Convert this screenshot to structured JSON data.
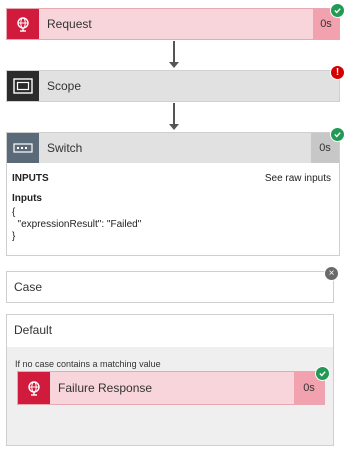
{
  "request": {
    "label": "Request",
    "duration": "0s",
    "icon": "globe-icon",
    "status": "success"
  },
  "scope": {
    "label": "Scope",
    "icon": "scope-icon",
    "status": "error",
    "status_glyph": "!"
  },
  "switch": {
    "label": "Switch",
    "duration": "0s",
    "icon": "switch-icon",
    "status": "success",
    "inputs_header": "INPUTS",
    "raw_link": "See raw inputs",
    "inputs_label": "Inputs",
    "code_lines": [
      "{",
      "  \"expressionResult\": \"Failed\"",
      "}"
    ]
  },
  "case": {
    "label": "Case",
    "close_glyph": "×"
  },
  "default": {
    "label": "Default",
    "no_case_text": "If no case contains a matching value",
    "failure": {
      "label": "Failure Response",
      "duration": "0s",
      "icon": "globe-icon",
      "status": "success"
    }
  },
  "colors": {
    "success": "#229954",
    "error": "#d40000",
    "request_accent": "#d11b3c",
    "scope_accent": "#2b2b2b",
    "switch_accent": "#5b6a78"
  }
}
